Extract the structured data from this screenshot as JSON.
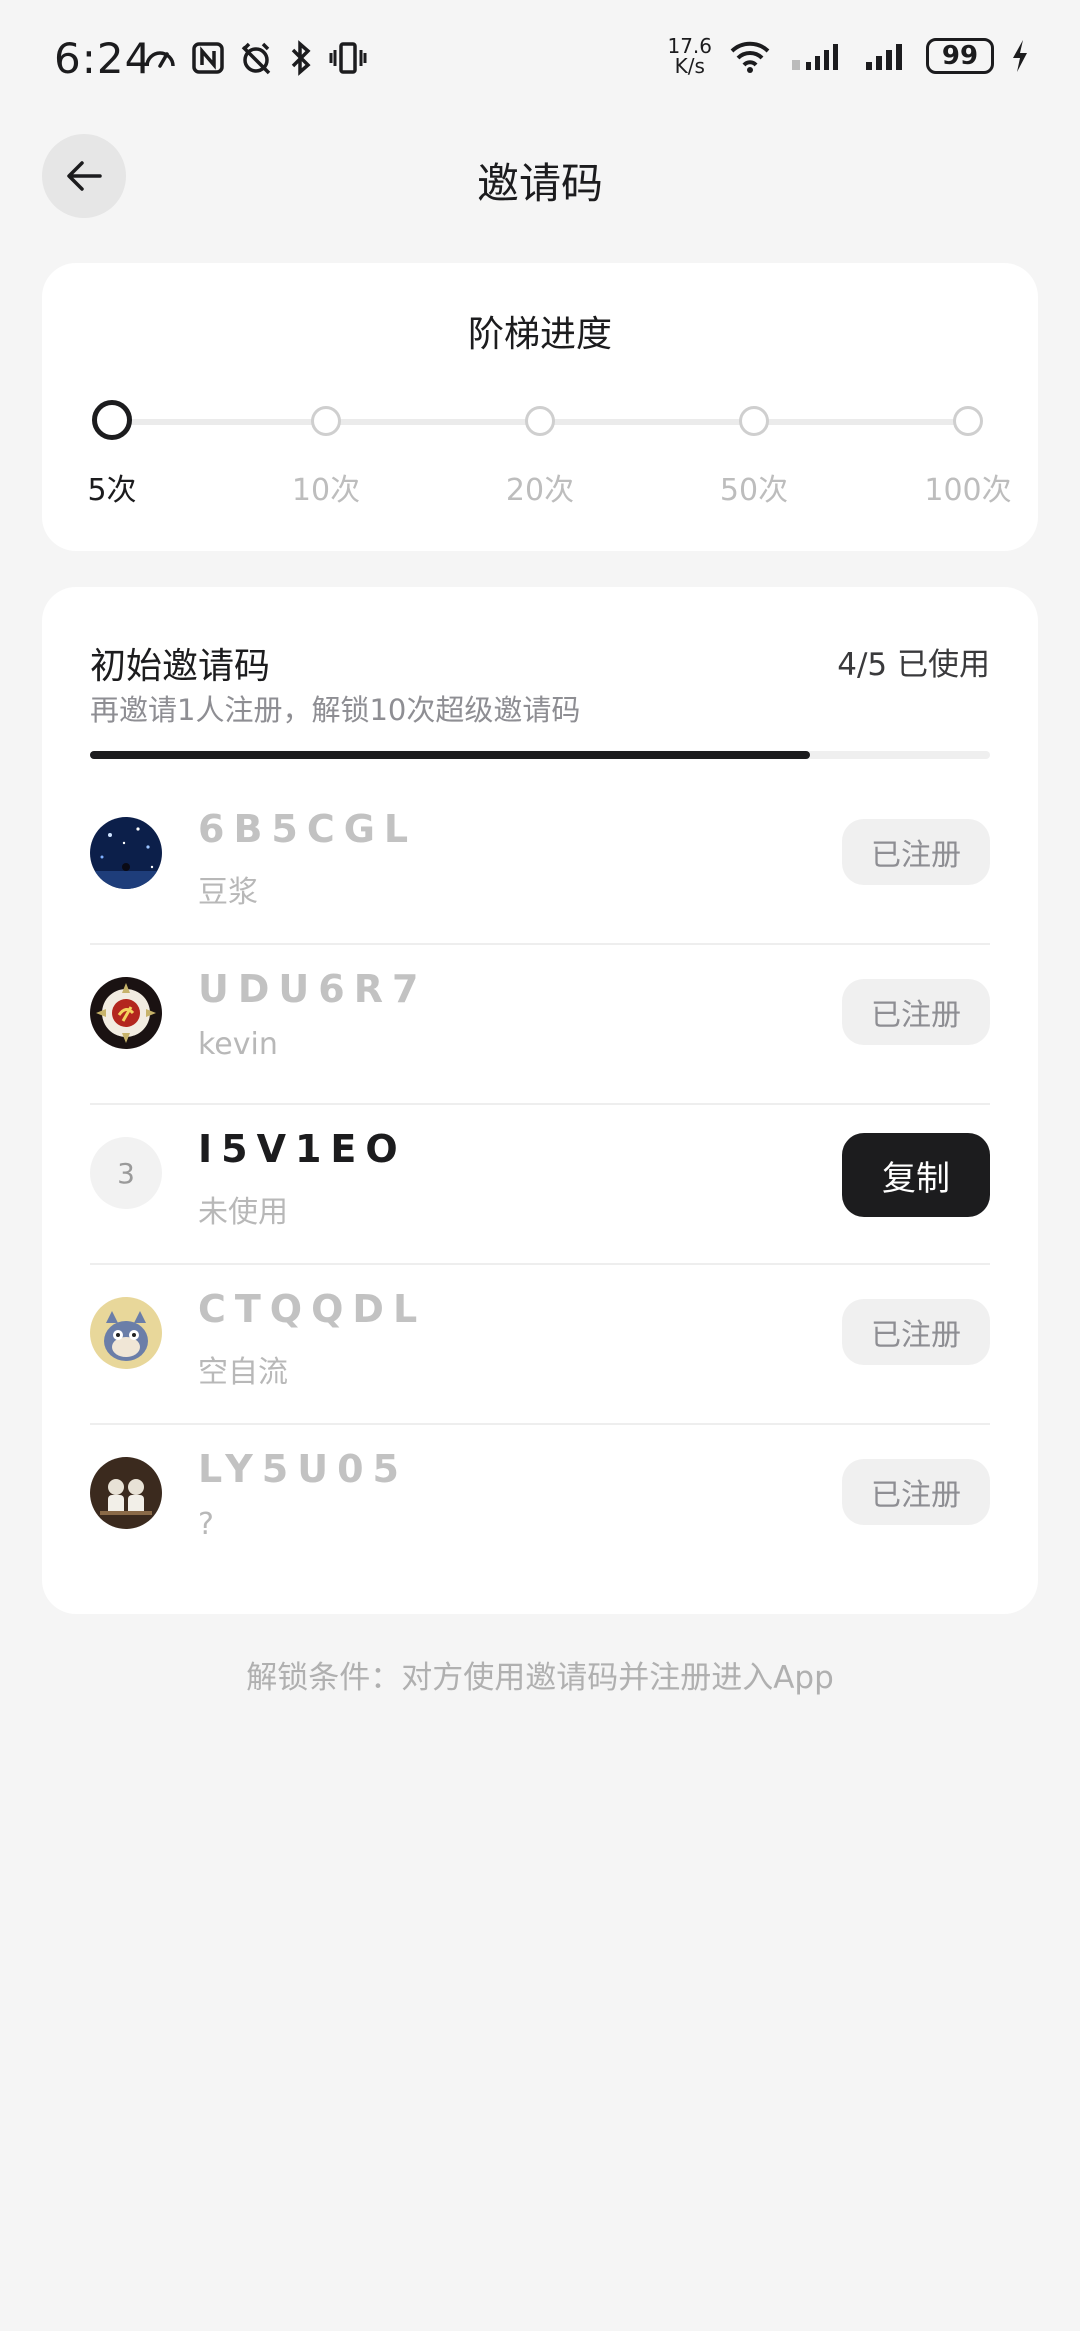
{
  "status_bar": {
    "time": "6:24",
    "net_speed_value": "17.6",
    "net_speed_unit": "K/s",
    "battery": "99"
  },
  "header": {
    "title": "邀请码",
    "back_icon": "arrow-left-icon"
  },
  "ladder": {
    "title": "阶梯进度",
    "steps": [
      "5次",
      "10次",
      "20次",
      "50次",
      "100次"
    ],
    "current_step": 0
  },
  "invite": {
    "title": "初始邀请码",
    "usage": "4/5 已使用",
    "subtitle": "再邀请1人注册，解锁10次超级邀请码",
    "progress": 0.8,
    "rows": [
      {
        "code": "6B5CGL",
        "user": "豆浆",
        "button": "已注册",
        "avatar": "avatar-image"
      },
      {
        "code": "UDU6R7",
        "user": "kevin",
        "button": "已注册",
        "avatar": "avatar-image"
      },
      {
        "code": "I5V1EO",
        "user": "未使用",
        "button": "复制",
        "avatar_number": "3"
      },
      {
        "code": "CTQQDL",
        "user": "空自流",
        "button": "已注册",
        "avatar": "avatar-image"
      },
      {
        "code": "LY5U05",
        "user": "?",
        "button": "已注册",
        "avatar": "avatar-image"
      }
    ]
  },
  "footer": {
    "note": "解锁条件：对方使用邀请码并注册进入App"
  },
  "colors": {
    "background": "#f5f5f5",
    "card": "#ffffff",
    "accent": "#1c1c1e",
    "muted": "#b8b8b8"
  }
}
